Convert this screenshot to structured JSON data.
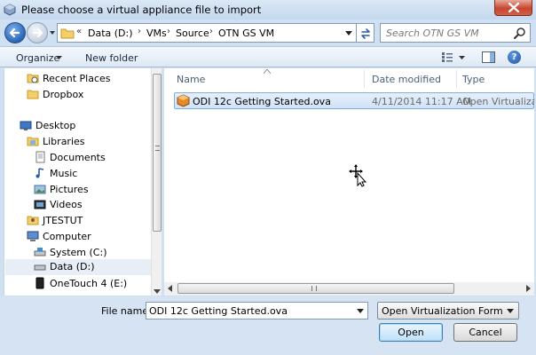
{
  "window": {
    "title": "Please choose a virtual appliance file to import",
    "close_icon": "close-icon"
  },
  "address": {
    "overflow": "«",
    "crumbs": [
      "Data (D:)",
      "VMs",
      "Source",
      "OTN GS VM"
    ],
    "search_placeholder": "Search OTN GS VM"
  },
  "toolbar": {
    "organize": "Organize",
    "new_folder": "New folder"
  },
  "sidebar": {
    "items": [
      {
        "label": "Recent Places",
        "icon": "recent-places-icon"
      },
      {
        "label": "Dropbox",
        "icon": "dropbox-folder-icon"
      },
      {
        "label": "Desktop",
        "icon": "desktop-icon"
      },
      {
        "label": "Libraries",
        "icon": "libraries-icon"
      },
      {
        "label": "Documents",
        "icon": "documents-icon"
      },
      {
        "label": "Music",
        "icon": "music-icon"
      },
      {
        "label": "Pictures",
        "icon": "pictures-icon"
      },
      {
        "label": "Videos",
        "icon": "videos-icon"
      },
      {
        "label": "JTESTUT",
        "icon": "user-folder-icon"
      },
      {
        "label": "Computer",
        "icon": "computer-icon"
      },
      {
        "label": "System (C:)",
        "icon": "drive-icon"
      },
      {
        "label": "Data (D:)",
        "icon": "drive-icon"
      },
      {
        "label": "OneTouch 4 (E:)",
        "icon": "external-drive-icon"
      }
    ]
  },
  "files": {
    "columns": {
      "name": "Name",
      "date": "Date modified",
      "type": "Type"
    },
    "rows": [
      {
        "name": "ODI 12c Getting Started.ova",
        "date": "4/11/2014 11:17 AM",
        "type": "Open Virtualization"
      }
    ]
  },
  "footer": {
    "file_name_label": "File name:",
    "file_name_value": "ODI 12c Getting Started.ova",
    "file_type_value": "Open Virtualization Format (*.o",
    "open_label": "Open",
    "cancel_label": "Cancel"
  },
  "colors": {
    "chrome": "#cfe0f2",
    "selection": "#cfe2f8",
    "close": "#c7452f"
  }
}
